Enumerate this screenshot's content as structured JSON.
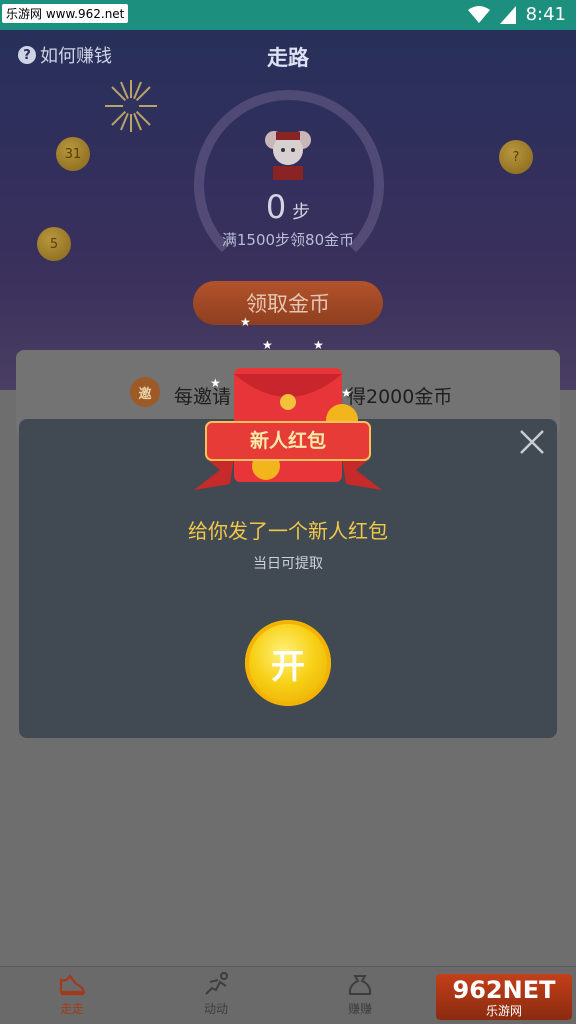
{
  "status_bar": {
    "watermark": "乐游网 www.962.net",
    "time": "8:41"
  },
  "header": {
    "help_label": "如何赚钱",
    "title": "走路"
  },
  "coins": {
    "left_top": "31",
    "left_bottom": "5",
    "right": "?"
  },
  "steps": {
    "value": "0",
    "unit": "步",
    "goal_text": "满1500步领80金币"
  },
  "claim_button": "领取金币",
  "invite": {
    "icon_text": "邀",
    "text_left": "每邀请",
    "text_right": "得2000金币"
  },
  "modal": {
    "badge": "新人红包",
    "title": "给你发了一个新人红包",
    "subtitle": "当日可提取",
    "open_button": "开"
  },
  "bottom_nav": [
    {
      "label": "走走",
      "icon": "shoe-icon",
      "active": true
    },
    {
      "label": "动动",
      "icon": "run-icon",
      "active": false
    },
    {
      "label": "赚赚",
      "icon": "money-bag-icon",
      "active": false
    }
  ],
  "watermark_bottom": {
    "big": "962NET",
    "small": "乐游网"
  },
  "colors": {
    "modal_bg": "#414a53",
    "modal_title": "#f1c84a",
    "open_button": "#f7cf15",
    "active_nav": "#a13a1c",
    "status_bar": "#1d8f7f"
  }
}
